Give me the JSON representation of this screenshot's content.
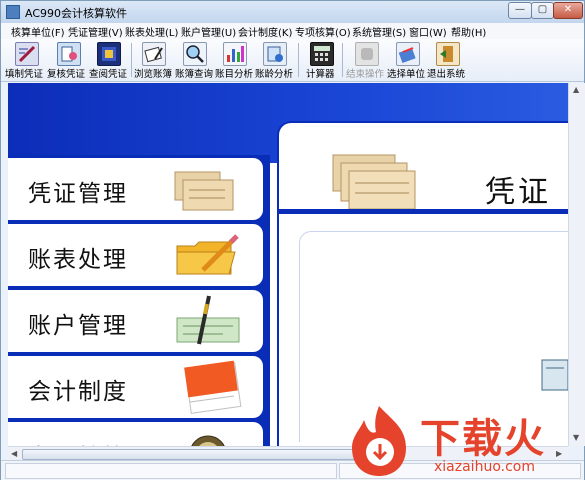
{
  "window": {
    "title": "AC990会计核算软件",
    "controls": [
      "minimize",
      "maximize",
      "close"
    ]
  },
  "menu": {
    "items": [
      "核算单位(F)",
      "凭证管理(V)",
      "账表处理(L)",
      "账户管理(U)",
      "会计制度(K)",
      "专项核算(O)",
      "系统管理(S)",
      "窗口(W)",
      "帮助(H)"
    ]
  },
  "toolbar": {
    "buttons": [
      {
        "label": "填制凭证",
        "icon": "edit-voucher-icon",
        "enabled": true
      },
      {
        "label": "复核凭证",
        "icon": "review-voucher-icon",
        "enabled": true
      },
      {
        "label": "查阅凭证",
        "icon": "view-voucher-icon",
        "enabled": true
      },
      {
        "label": "浏览账簿",
        "icon": "browse-ledger-icon",
        "enabled": true
      },
      {
        "label": "账簿查询",
        "icon": "ledger-query-icon",
        "enabled": true
      },
      {
        "label": "账目分析",
        "icon": "account-analysis-icon",
        "enabled": true
      },
      {
        "label": "账龄分析",
        "icon": "aging-analysis-icon",
        "enabled": true
      },
      {
        "label": "计算器",
        "icon": "calculator-icon",
        "enabled": true
      },
      {
        "label": "结束操作",
        "icon": "end-operation-icon",
        "enabled": false
      },
      {
        "label": "选择单位",
        "icon": "select-unit-icon",
        "enabled": true
      },
      {
        "label": "退出系统",
        "icon": "exit-icon",
        "enabled": true
      }
    ]
  },
  "nav": {
    "items": [
      "凭证管理",
      "账表处理",
      "账户管理",
      "会计制度",
      "专项核算"
    ]
  },
  "panel": {
    "title": "凭证"
  },
  "watermark": {
    "brand_cn": "下载火",
    "brand_url": "xiazaihuo.com"
  },
  "colors": {
    "band_blue": "#0a2db8",
    "watermark_red": "#e5432b"
  }
}
